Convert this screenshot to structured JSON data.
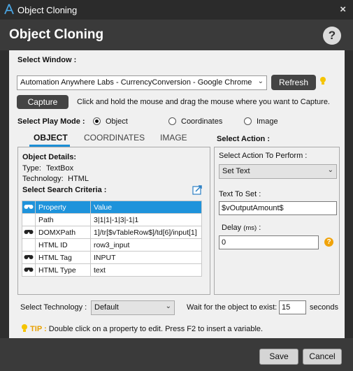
{
  "window": {
    "title": "Object Cloning",
    "close": "×"
  },
  "header": {
    "title": "Object Cloning",
    "help": "?"
  },
  "select_window": {
    "label": "Select Window :",
    "value": "Automation Anywhere Labs - CurrencyConversion - Google Chrome",
    "refresh": "Refresh"
  },
  "capture": {
    "button": "Capture",
    "hint": "Click and hold the mouse and drag the mouse where you want to Capture."
  },
  "play_mode": {
    "label": "Select Play Mode :",
    "options": [
      "Object",
      "Coordinates",
      "Image"
    ],
    "selected": "Object"
  },
  "tabs": [
    "OBJECT",
    "COORDINATES",
    "IMAGE"
  ],
  "object_details": {
    "title": "Object Details:",
    "type_label": "Type:",
    "type_value": "TextBox",
    "tech_label": "Technology:",
    "tech_value": "HTML"
  },
  "criteria": {
    "title": "Select Search Criteria :",
    "headers": [
      "Property",
      "Value"
    ],
    "rows": [
      {
        "icon": false,
        "property": "Path",
        "value": "3|1|1|-1|3|-1|1"
      },
      {
        "icon": true,
        "property": "DOMXPath",
        "value": "1]/tr[$vTableRow$]/td[6]/input[1]"
      },
      {
        "icon": false,
        "property": "HTML ID",
        "value": "row3_input"
      },
      {
        "icon": true,
        "property": "HTML Tag",
        "value": "INPUT"
      },
      {
        "icon": true,
        "property": "HTML Type",
        "value": "text"
      }
    ]
  },
  "action": {
    "title": "Select Action :",
    "perform_label": "Select Action To Perform :",
    "perform_value": "Set Text",
    "text_label": "Text To Set :",
    "text_value": "$vOutputAmount$",
    "delay_label": "Delay",
    "delay_unit": "(ms)",
    "delay_colon": ":",
    "delay_value": "0",
    "help": "?"
  },
  "technology": {
    "label": "Select Technology :",
    "value": "Default"
  },
  "wait": {
    "label": "Wait for the object to exist:",
    "value": "15",
    "unit": "seconds"
  },
  "tip": {
    "label": "TIP :",
    "text": "Double click on a property to edit. Press F2 to insert a variable."
  },
  "footer": {
    "save": "Save",
    "cancel": "Cancel"
  },
  "colors": {
    "accent": "#1e93db",
    "tip": "#e8a000",
    "titlebar": "#2b2b2b",
    "panel": "#f0f0f0"
  }
}
